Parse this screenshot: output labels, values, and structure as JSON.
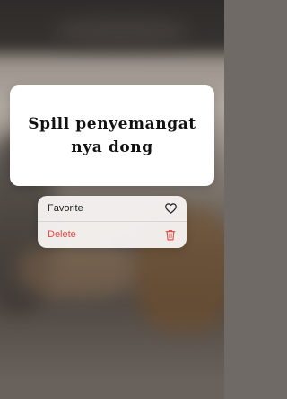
{
  "post": {
    "text": "Spill penyemangat nya dong"
  },
  "context_menu": {
    "items": [
      {
        "label": "Favorite",
        "icon": "heart-icon",
        "color": "#1c1c1e"
      },
      {
        "label": "Delete",
        "icon": "trash-icon",
        "color": "#e5473f"
      }
    ]
  },
  "colors": {
    "card_background": "#ffffff",
    "menu_background": "#f6f3f1",
    "destructive": "#e5473f"
  }
}
